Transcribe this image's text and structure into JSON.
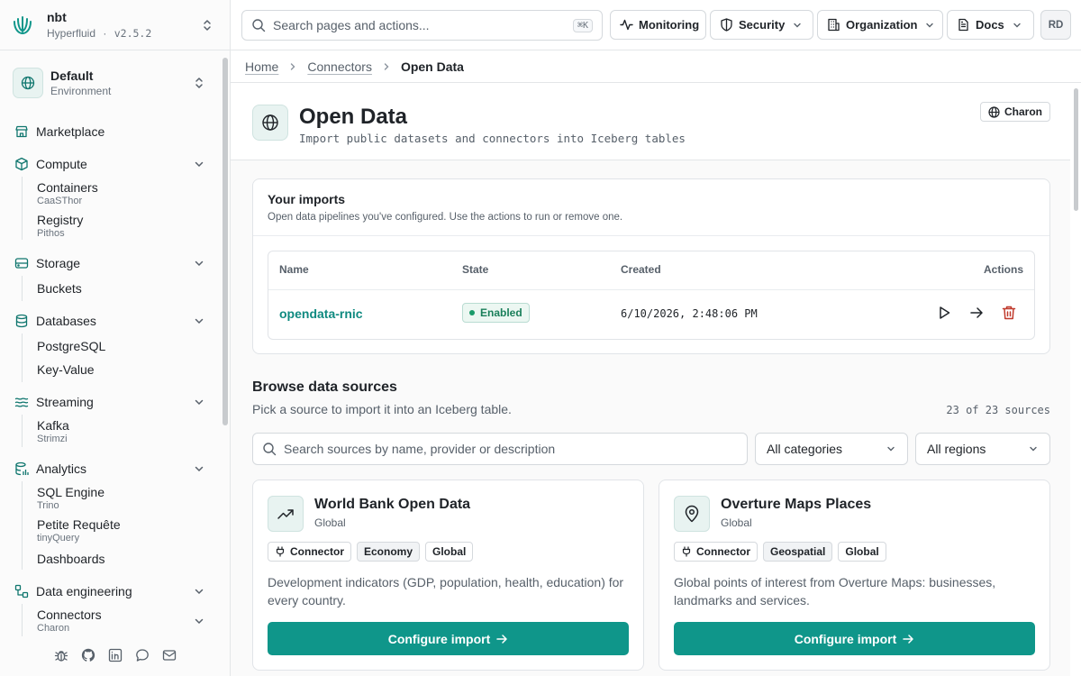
{
  "app": {
    "name": "nbt",
    "org": "Hyperfluid",
    "separator": "·",
    "version": "v2.5.2"
  },
  "environment": {
    "name": "Default",
    "label": "Environment"
  },
  "sidebar": {
    "items": [
      {
        "label": "Marketplace",
        "icon": "store-icon"
      },
      {
        "label": "Compute",
        "icon": "box-icon",
        "children": [
          {
            "label": "Containers",
            "caption": "CaaSThor"
          },
          {
            "label": "Registry",
            "caption": "Pithos"
          }
        ]
      },
      {
        "label": "Storage",
        "icon": "hard-drive-icon",
        "children": [
          {
            "label": "Buckets"
          }
        ]
      },
      {
        "label": "Databases",
        "icon": "database-icon",
        "children": [
          {
            "label": "PostgreSQL"
          },
          {
            "label": "Key-Value"
          }
        ]
      },
      {
        "label": "Streaming",
        "icon": "waves-icon",
        "children": [
          {
            "label": "Kafka",
            "caption": "Strimzi"
          }
        ]
      },
      {
        "label": "Analytics",
        "icon": "database-chart-icon",
        "children": [
          {
            "label": "SQL Engine",
            "caption": "Trino"
          },
          {
            "label": "Petite Requête",
            "caption": "tinyQuery"
          },
          {
            "label": "Dashboards"
          }
        ]
      },
      {
        "label": "Data engineering",
        "icon": "workflow-icon",
        "children": [
          {
            "label": "Connectors",
            "caption": "Charon"
          }
        ]
      }
    ],
    "footer_icons": [
      "bug-icon",
      "github-icon",
      "linkedin-icon",
      "chat-icon",
      "mail-icon"
    ]
  },
  "topbar": {
    "search_placeholder": "Search pages and actions...",
    "shortcut": "⌘K",
    "monitoring": "Monitoring",
    "security": "Security",
    "organization": "Organization",
    "docs": "Docs",
    "avatar": "RD"
  },
  "breadcrumb": {
    "home": "Home",
    "connectors": "Connectors",
    "current": "Open Data"
  },
  "page": {
    "title": "Open Data",
    "subtitle": "Import public datasets and connectors into Iceberg tables",
    "badge": "Charon"
  },
  "imports": {
    "title": "Your imports",
    "subtitle": "Open data pipelines you've configured. Use the actions to run or remove one.",
    "columns": {
      "name": "Name",
      "state": "State",
      "created": "Created",
      "actions": "Actions"
    },
    "rows": [
      {
        "name": "opendata-rnic",
        "state": "Enabled",
        "created": "6/10/2026, 2:48:06 PM"
      }
    ]
  },
  "browse": {
    "title": "Browse data sources",
    "subtitle": "Pick a source to import it into an Iceberg table.",
    "count": "23 of 23 sources",
    "search_placeholder": "Search sources by name, provider or description",
    "category_filter": "All categories",
    "region_filter": "All regions",
    "sources": [
      {
        "title": "World Bank Open Data",
        "region": "Global",
        "icon": "trending-up-icon",
        "tags": [
          "Connector",
          "Economy",
          "Global"
        ],
        "description": "Development indicators (GDP, population, health, education) for every country.",
        "button": "Configure import"
      },
      {
        "title": "Overture Maps Places",
        "region": "Global",
        "icon": "map-pin-icon",
        "tags": [
          "Connector",
          "Geospatial",
          "Global"
        ],
        "description": "Global points of interest from Overture Maps: businesses, landmarks and services.",
        "button": "Configure import"
      }
    ]
  },
  "colors": {
    "accent": "#0f968a",
    "accent_text": "#0f8a80",
    "danger": "#c0392b",
    "success": "#1a7f5a"
  }
}
